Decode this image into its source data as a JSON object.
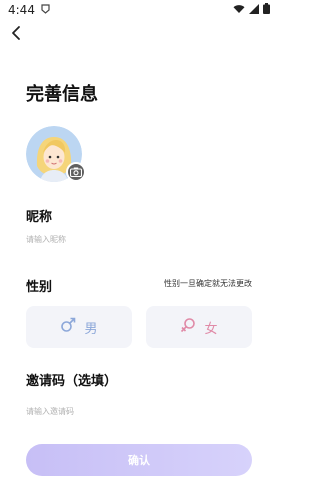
{
  "status_bar": {
    "time": "4:44"
  },
  "header": {
    "title": "完善信息"
  },
  "nickname": {
    "label": "昵称",
    "placeholder": "请输入昵称"
  },
  "gender": {
    "label": "性别",
    "hint": "性别一旦确定就无法更改",
    "male_label": "男",
    "female_label": "女"
  },
  "invite": {
    "label": "邀请码（选填）",
    "placeholder": "请输入邀请码"
  },
  "confirm_label": "确认",
  "colors": {
    "accent": "#c7bff6",
    "male": "#8ca7d9",
    "female": "#e08aa7",
    "card_bg": "#f3f4f9"
  }
}
